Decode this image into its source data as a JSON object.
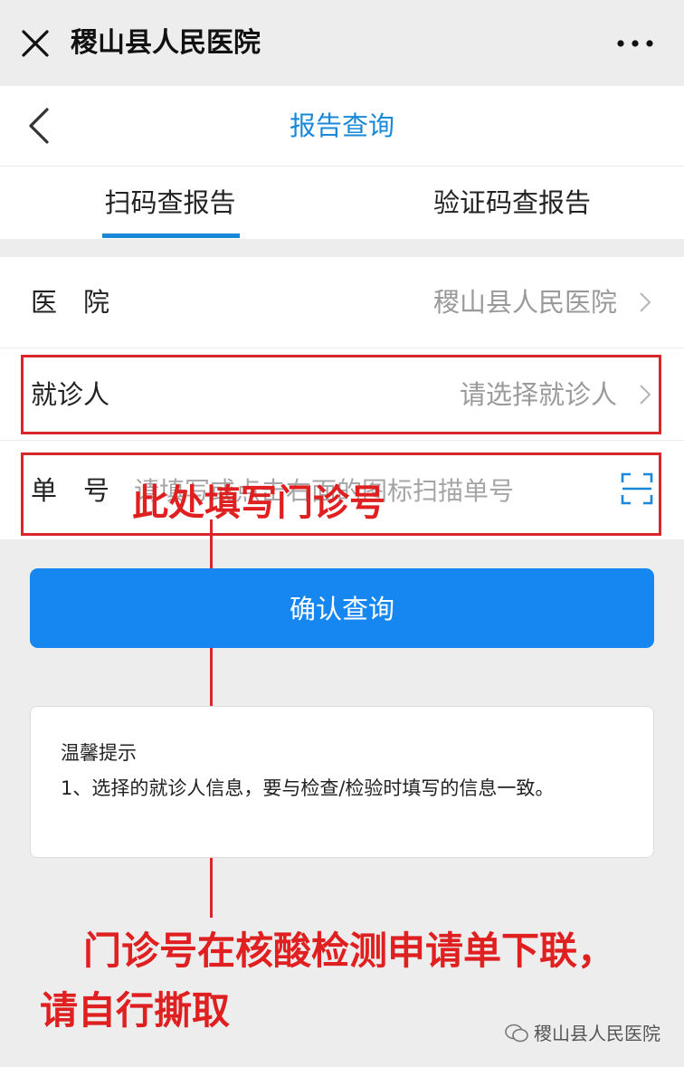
{
  "header": {
    "app_title": "稷山县人民医院",
    "close_icon": "close-icon",
    "more_icon": "more-dots-icon"
  },
  "nav": {
    "page_title": "报告查询",
    "back_icon": "back-chevron-icon"
  },
  "tabs": [
    {
      "label": "扫码查报告",
      "active": true
    },
    {
      "label": "验证码查报告",
      "active": false
    }
  ],
  "form": {
    "hospital_label": "医　院",
    "hospital_value": "稷山县人民医院",
    "patient_label": "就诊人",
    "patient_placeholder": "请选择就诊人",
    "number_label": "单　号",
    "number_placeholder": "请填写或点击右面的图标扫描单号",
    "scan_icon": "scan-icon"
  },
  "confirm_button": "确认查询",
  "tips": {
    "title": "温馨提示",
    "body": "1、选择的就诊人信息，要与检查/检验时填写的信息一致。"
  },
  "annotations": {
    "fill_here": "此处填写门诊号",
    "source_note": "门诊号在核酸检测申请单下联，请自行撕取"
  },
  "watermark": "稷山县人民医院",
  "colors": {
    "accent": "#1a88d9",
    "button": "#1686f0",
    "annotation_red": "#e02020"
  }
}
